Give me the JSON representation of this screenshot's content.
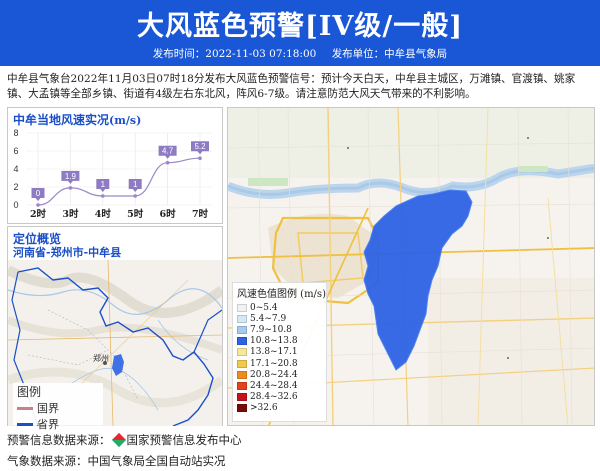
{
  "header": {
    "title": "大风蓝色预警[IV级/一般]",
    "publish_time_label": "发布时间：2022-11-03 07:18:00",
    "publisher_label": "发布单位：中牟县气象局"
  },
  "description": "中牟县气象台2022年11月03日07时18分发布大风蓝色预警信号：预计今天白天，中牟县主城区，万滩镇、官渡镇、姚家镇、大孟镇等全部乡镇、街道有4级左右东北风，阵风6-7级。请注意防范大风天气带来的不利影响。",
  "chart_panel": {
    "title": "中牟当地风速实况",
    "unit": "(m/s)"
  },
  "chart_data": {
    "type": "line",
    "categories": [
      "2时",
      "3时",
      "4时",
      "5时",
      "6时",
      "7时"
    ],
    "values": [
      0,
      1.9,
      1,
      1,
      4.7,
      5.2
    ],
    "data_labels": [
      "0",
      "1.9",
      "1",
      "1",
      "4.7",
      "5.2"
    ],
    "y_ticks": [
      "0",
      "2",
      "4",
      "6",
      "8"
    ],
    "ylim": [
      0,
      8
    ],
    "grid": true,
    "line_color": "#9a86c8",
    "label_color": "#8e7cc3"
  },
  "location_panel": {
    "title": "定位概览",
    "subtitle": "河南省-郑州市-中牟县",
    "county_label": "郑州"
  },
  "small_legend": {
    "title": "图例",
    "items": [
      {
        "label": "国界",
        "color": "#c9808a"
      },
      {
        "label": "省界",
        "color": "#1a4fc8"
      }
    ]
  },
  "wind_legend": {
    "title": "风速色值图例 (m/s)",
    "items": [
      {
        "label": "0~5.4",
        "color": "#f2f2f2"
      },
      {
        "label": "5.4~7.9",
        "color": "#d4e8f7"
      },
      {
        "label": "7.9~10.8",
        "color": "#a6cbee"
      },
      {
        "label": "10.8~13.8",
        "color": "#2e63e6"
      },
      {
        "label": "13.8~17.1",
        "color": "#f6e79a"
      },
      {
        "label": "17.1~20.8",
        "color": "#f2c94a"
      },
      {
        "label": "20.8~24.4",
        "color": "#f08a1e"
      },
      {
        "label": "24.4~28.4",
        "color": "#e3421b"
      },
      {
        "label": "28.4~32.6",
        "color": "#c2141a"
      },
      {
        "label": ">32.6",
        "color": "#7a0a0a"
      }
    ]
  },
  "footer": {
    "warning_source_label": "预警信息数据来源：",
    "warning_source": "国家预警信息发布中心",
    "weather_source_label": "气象数据来源：",
    "weather_source": "中国气象局全国自动站实况"
  },
  "colors": {
    "header_bg": "#1a57d6",
    "accent": "#1a4fc8",
    "warning_area": "#2e63e6"
  }
}
